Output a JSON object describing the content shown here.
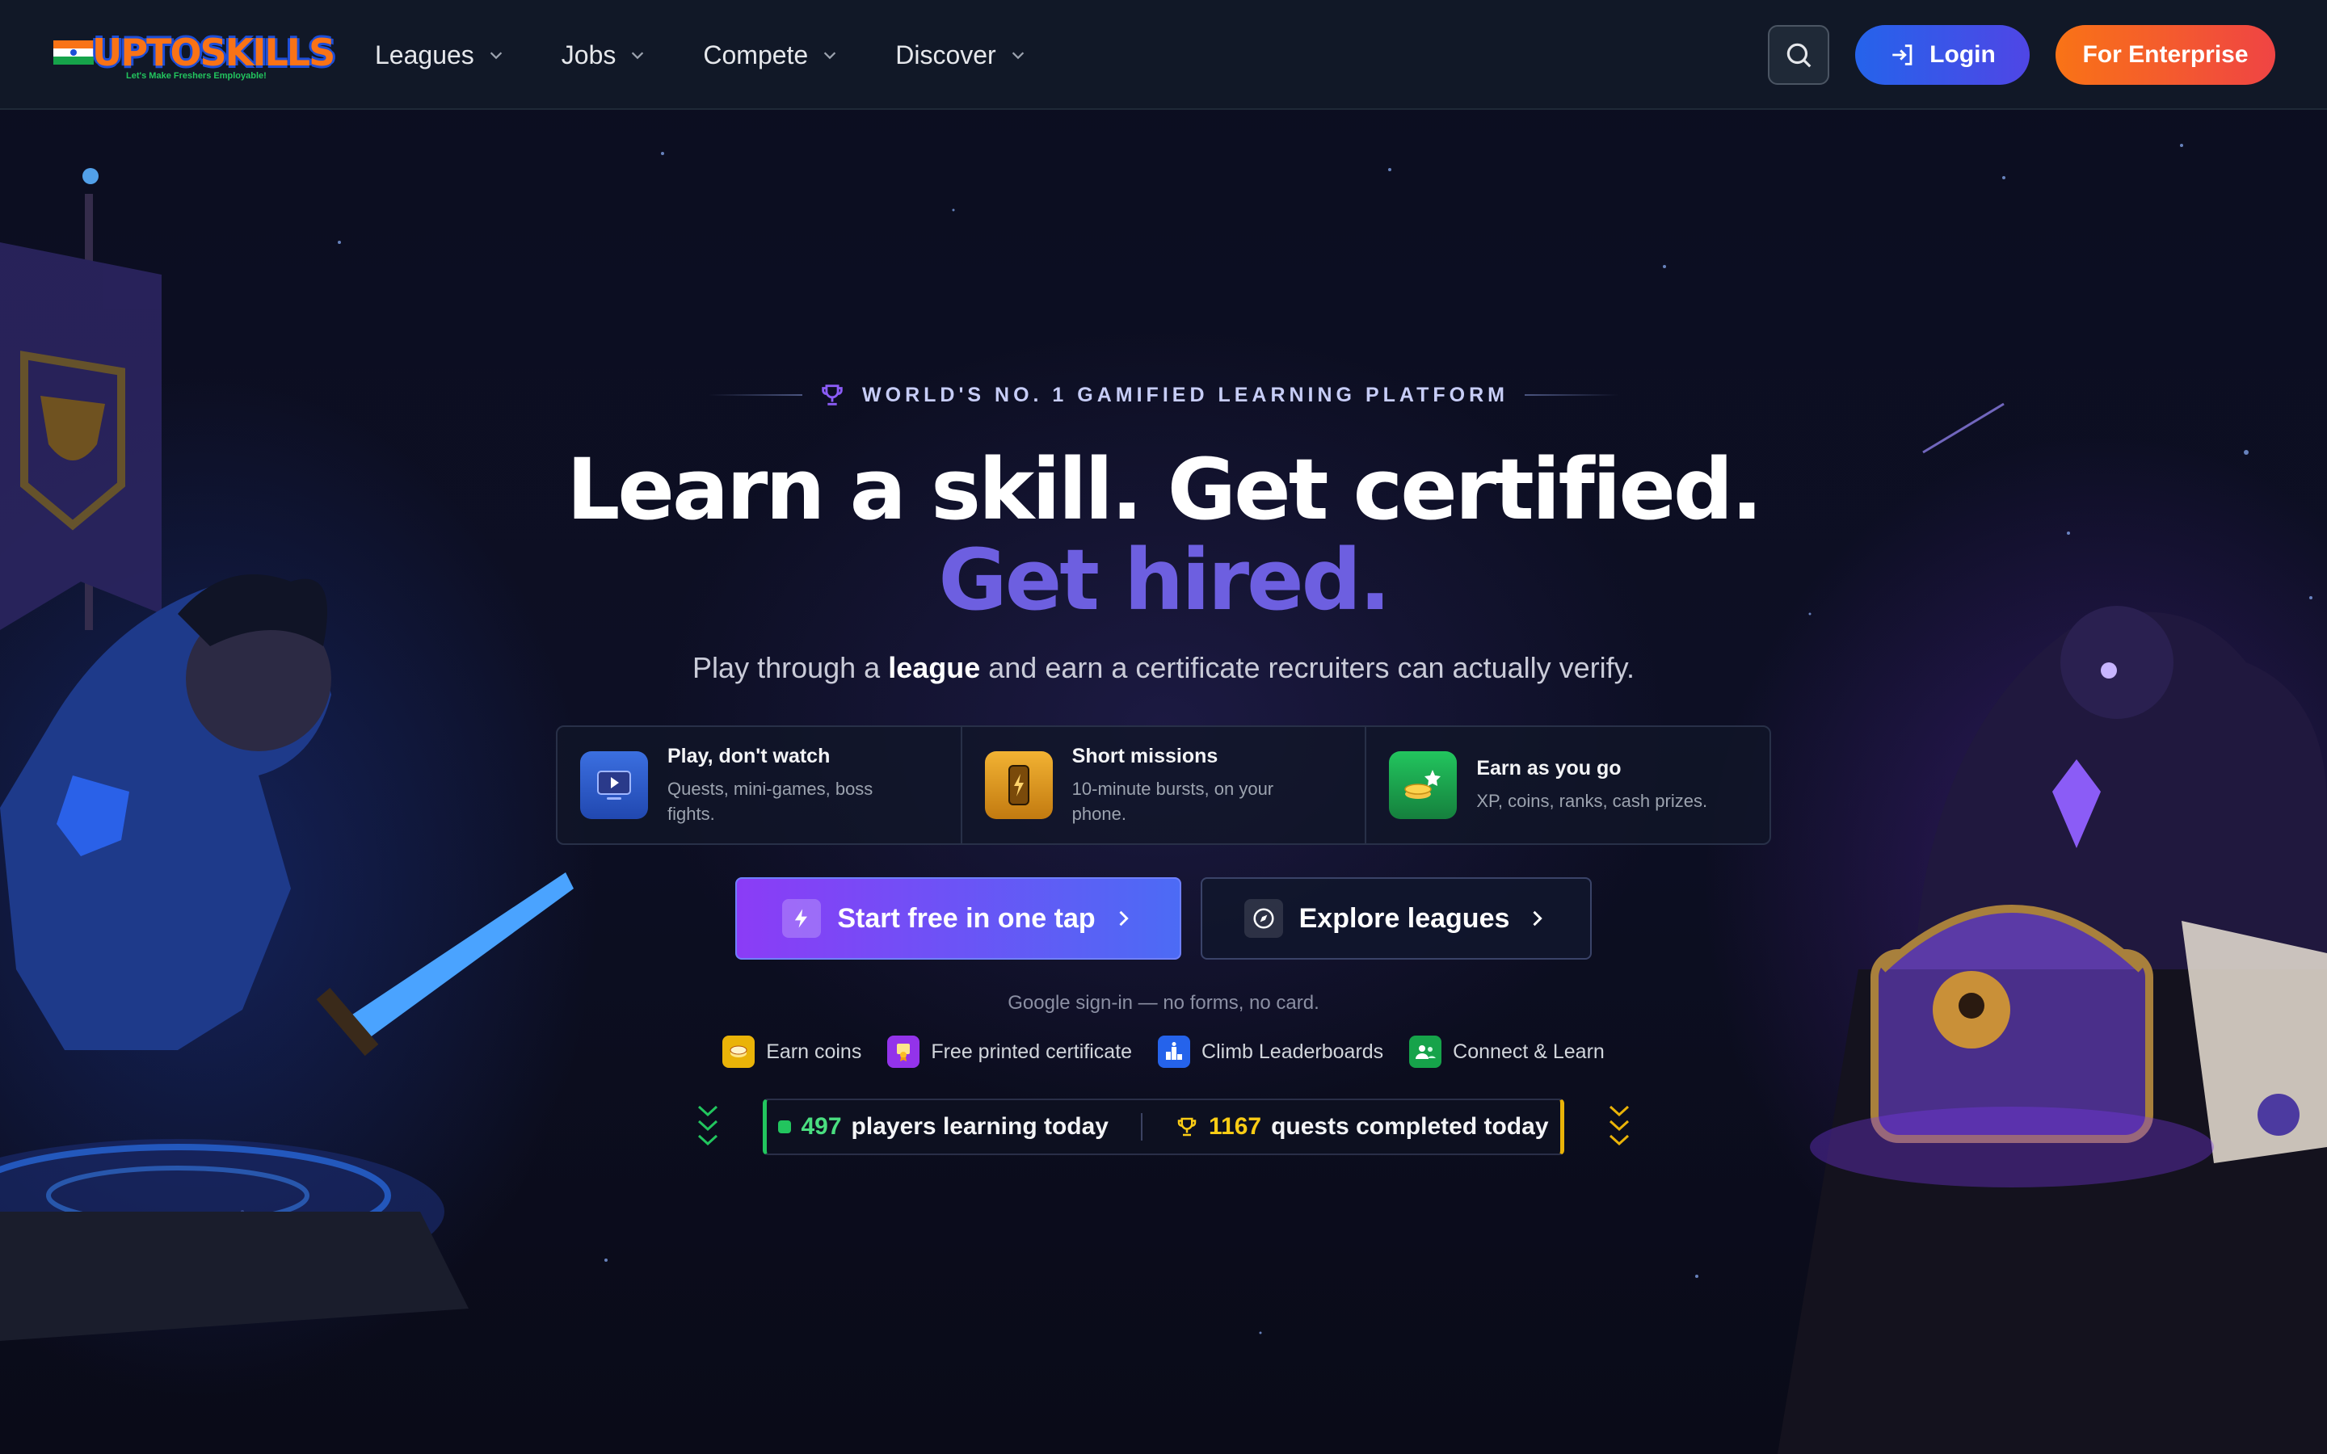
{
  "brand": {
    "logo_text": "UPTOSKILLS",
    "tagline": "Let's Make Freshers Employable!",
    "colors": {
      "accent": "#4c6bf5",
      "primary_purple": "#8b3cf6",
      "orange": "#f97316",
      "green": "#22c55e",
      "yellow": "#eab308"
    }
  },
  "nav": {
    "items": [
      {
        "label": "Leagues",
        "icon": "chevron-down-icon"
      },
      {
        "label": "Jobs",
        "icon": "chevron-down-icon"
      },
      {
        "label": "Compete",
        "icon": "chevron-down-icon"
      },
      {
        "label": "Discover",
        "icon": "chevron-down-icon"
      }
    ],
    "search_icon": "search-icon",
    "login_label": "Login",
    "login_icon": "login-icon",
    "enterprise_label": "For Enterprise"
  },
  "hero": {
    "eyebrow": "WORLD'S NO. 1 GAMIFIED LEARNING PLATFORM",
    "eyebrow_icon": "trophy-icon",
    "headline_line1": "Learn a skill. Get certified.",
    "headline_line2": "Get hired.",
    "sub_before": "Play through a",
    "sub_bold": "league",
    "sub_after": "and earn a certificate recruiters can actually verify."
  },
  "features": [
    {
      "title": "Play, don't watch",
      "desc": "Quests, mini-games, boss fights.",
      "icon": "play-screen-icon",
      "color": "#2f5fd6"
    },
    {
      "title": "Short missions",
      "desc": "10-minute bursts, on your phone.",
      "icon": "phone-bolt-icon",
      "color": "#e59b16"
    },
    {
      "title": "Earn as you go",
      "desc": "XP, coins, ranks, cash prizes.",
      "icon": "coins-star-icon",
      "color": "#16a34a"
    }
  ],
  "cta": {
    "primary_label": "Start free in one tap",
    "primary_icon": "bolt-icon",
    "secondary_label": "Explore leagues",
    "secondary_icon": "compass-icon",
    "note": "Google sign-in — no forms, no card."
  },
  "perks": [
    {
      "label": "Earn coins",
      "icon": "coin-icon",
      "color": "#eab308"
    },
    {
      "label": "Free printed certificate",
      "icon": "certificate-icon",
      "color": "#9333ea"
    },
    {
      "label": "Climb Leaderboards",
      "icon": "leaderboard-icon",
      "color": "#2563eb"
    },
    {
      "label": "Connect & Learn",
      "icon": "people-icon",
      "color": "#16a34a"
    }
  ],
  "stats": {
    "players_count": "497",
    "players_label": "players learning today",
    "quests_count": "1167",
    "quests_label": "quests completed today"
  }
}
